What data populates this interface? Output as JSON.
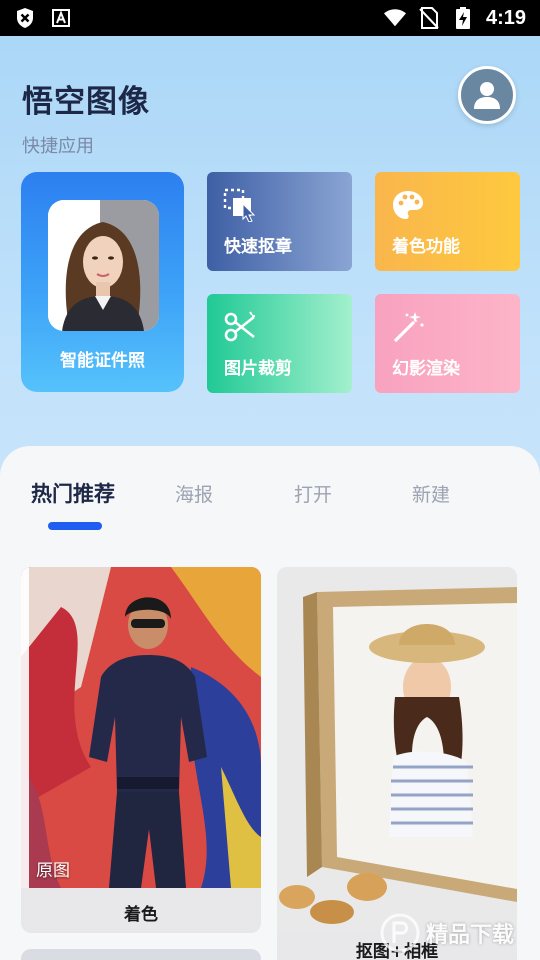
{
  "status_bar": {
    "time": "4:19",
    "left_icons": [
      "shield-x-icon",
      "a-box-icon"
    ],
    "right_icons": [
      "wifi-icon",
      "no-sim-icon",
      "battery-charging-icon"
    ]
  },
  "header": {
    "title": "悟空图像",
    "subtitle": "快捷应用",
    "avatar_icon": "user-icon"
  },
  "quick_apps": {
    "id_photo": {
      "label": "智能证件照"
    },
    "tiles": [
      {
        "label": "快速抠章",
        "icon": "select-cursor-icon"
      },
      {
        "label": "着色功能",
        "icon": "palette-icon"
      },
      {
        "label": "图片裁剪",
        "icon": "scissors-icon"
      },
      {
        "label": "幻影渲染",
        "icon": "magic-wand-icon"
      }
    ]
  },
  "tabs": [
    {
      "label": "热门推荐",
      "active": true
    },
    {
      "label": "海报",
      "active": false
    },
    {
      "label": "打开",
      "active": false
    },
    {
      "label": "新建",
      "active": false
    }
  ],
  "recommendations": [
    {
      "caption": "着色",
      "tag": "原图"
    },
    {
      "caption": "抠图+相框"
    }
  ],
  "watermark": {
    "text": "精品下载"
  },
  "colors": {
    "accent": "#1e5ef0",
    "title": "#1d2746",
    "tab_inactive": "#9ca3b1"
  }
}
